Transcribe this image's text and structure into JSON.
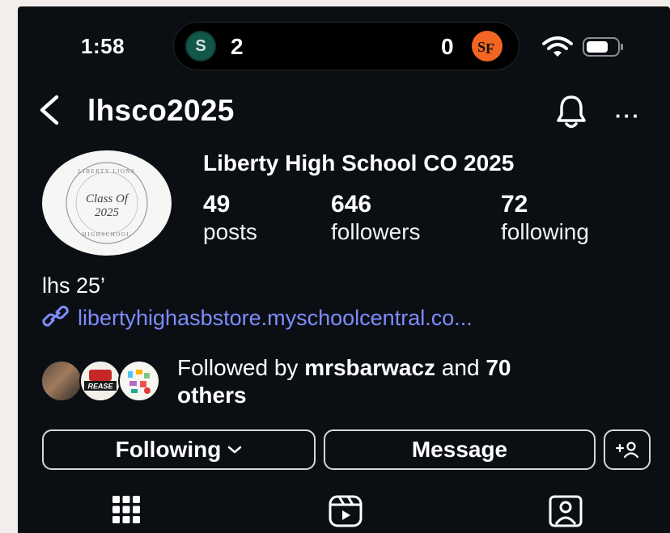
{
  "status_bar": {
    "time": "1:58",
    "live_activity": {
      "left_team_icon": "S",
      "left_score": "2",
      "right_score": "0",
      "right_team_icon": "SF",
      "left_color": "#13574a",
      "right_color": "#f26522"
    },
    "icons": [
      "wifi-icon",
      "battery-icon"
    ]
  },
  "header": {
    "username": "lhsco2025",
    "back_icon": "chevron-left-icon",
    "bell_icon": "bell-icon",
    "more_label": "···"
  },
  "profile": {
    "avatar_lines": [
      "LIBERTY LIONS",
      "Class Of",
      "2025",
      "HIGHSCHOOL"
    ],
    "name": "Liberty High School CO 2025",
    "stats": [
      {
        "value": "49",
        "label": "posts"
      },
      {
        "value": "646",
        "label": "followers"
      },
      {
        "value": "72",
        "label": "following"
      }
    ],
    "bio": "lhs 25’",
    "link": "libertyhighasbstore.myschoolcentral.co..."
  },
  "followed_by": {
    "prefix": "Followed by ",
    "user": "mrsbarwacz",
    "middle": " and ",
    "count": "70",
    "suffix": "others",
    "avatar_badge_text": "REASE"
  },
  "actions": {
    "following_label": "Following",
    "message_label": "Message",
    "add_user_icon": "add-user-icon"
  },
  "tabs": [
    "grid-icon",
    "reels-icon",
    "tagged-icon"
  ],
  "colors": {
    "background": "#0b0f14",
    "link": "#7f8cff",
    "button_border": "#d8d8d8"
  }
}
